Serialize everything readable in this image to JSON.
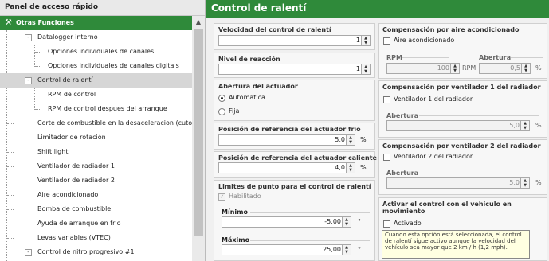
{
  "left_panel": {
    "header": "Panel de acceso rápido",
    "items": [
      {
        "label": "Otras Funciones"
      },
      {
        "label": "Datalogger interno"
      },
      {
        "label": "Opciones individuales de canales"
      },
      {
        "label": "Opciones individuales de canales digitais"
      },
      {
        "label": "Control de ralentí"
      },
      {
        "label": "RPM de control"
      },
      {
        "label": "RPM de control despues del arranque"
      },
      {
        "label": "Corte de combustible en la desaceleracion (cutoff)"
      },
      {
        "label": "Limitador de rotación"
      },
      {
        "label": "Shift light"
      },
      {
        "label": "Ventilador de radiador 1"
      },
      {
        "label": "Ventilador de radiador 2"
      },
      {
        "label": "Aire acondicionado"
      },
      {
        "label": "Bomba de combustible"
      },
      {
        "label": "Ayuda de arranque en frio"
      },
      {
        "label": "Levas variables (VTEC)"
      },
      {
        "label": "Control de nitro progresivo #1"
      }
    ]
  },
  "main": {
    "title": "Control de ralentí",
    "velocidad": {
      "label": "Velocidad del control de ralentí",
      "value": "1"
    },
    "nivel": {
      "label": "Nivel de reacción",
      "value": "1"
    },
    "abertura": {
      "label": "Abertura del actuador",
      "option1": "Automatica",
      "option2": "Fija"
    },
    "pos_frio": {
      "label": "Posición de referencia del actuador frio",
      "value": "5,0",
      "unit": "%"
    },
    "pos_caliente": {
      "label": "Posición de referencia del actuador caliente",
      "value": "4,0",
      "unit": "%"
    },
    "limites": {
      "label": "Limites de punto para el control de ralentí",
      "habilitado": "Habilitado",
      "minimo_label": "Mínimo",
      "minimo_value": "-5,00",
      "minimo_unit": "°",
      "maximo_label": "Máximo",
      "maximo_value": "25,00",
      "maximo_unit": "°"
    },
    "comp_aire": {
      "label": "Compensación por aire acondicionado",
      "check": "Aire acondicionado",
      "rpm_label": "RPM",
      "rpm_value": "100",
      "rpm_unit": "RPM",
      "abertura_label": "Abertura",
      "abertura_value": "0,5",
      "abertura_unit": "%"
    },
    "comp_vent1": {
      "label": "Compensación por ventilador 1 del radiador",
      "check": "Ventilador 1 del radiador",
      "abertura_label": "Abertura",
      "abertura_value": "5,0",
      "abertura_unit": "%"
    },
    "comp_vent2": {
      "label": "Compensación por ventilador 2 del radiador",
      "check": "Ventilador 2 del radiador",
      "abertura_label": "Abertura",
      "abertura_value": "5,0",
      "abertura_unit": "%"
    },
    "activar": {
      "label_line1": "Activar el control con el vehículo en",
      "label_line2": "movimiento",
      "check": "Activado",
      "tooltip": "Cuando esta opción está seleccionada, el control de ralentí sigue activo aunque la velocidad del vehículo sea mayor que 2 km / h (1,2 mph)."
    }
  }
}
